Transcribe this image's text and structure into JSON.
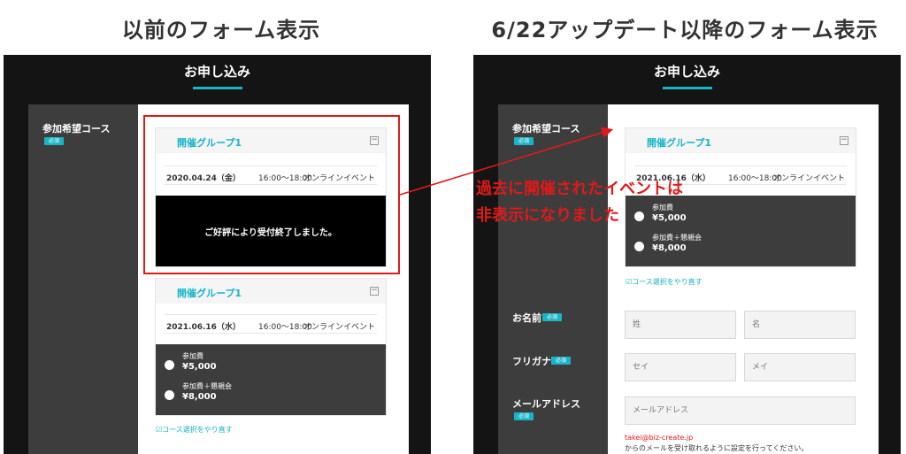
{
  "headings": {
    "before": "以前のフォーム表示",
    "after": "6/22アップデート以降のフォーム表示"
  },
  "form": {
    "title": "お申し込み",
    "course_label": "参加希望コース",
    "required_badge": "必須",
    "name_label": "お名前",
    "kana_label": "フリガナ",
    "email_label": "メールアドレス",
    "reset_link": "コース選択をやり直す"
  },
  "groups": {
    "past": {
      "title": "開催グループ1",
      "date": "2020.04.24（金）",
      "time": "16:00〜18:00",
      "type": "オンラインイベント",
      "closed_message": "ご好評により受付終了しました。"
    },
    "current": {
      "title": "開催グループ1",
      "date": "2021.06.16（水）",
      "time": "16:00〜18:00",
      "type": "オンラインイベント"
    }
  },
  "prices": [
    {
      "name": "参加費",
      "value": "¥5,000"
    },
    {
      "name": "参加費＋懇親会",
      "value": "¥8,000"
    }
  ],
  "inputs": {
    "last_name": "姓",
    "first_name": "名",
    "last_kana": "セイ",
    "first_kana": "メイ",
    "email": "メールアドレス"
  },
  "email_note": {
    "address": "takei@biz-create.jp",
    "text": "からのメールを受け取れるように設定を行ってください。"
  },
  "annotation": {
    "line1": "過去に開催されたイベントは",
    "line2": "非表示になりました"
  },
  "colors": {
    "accent": "#18b4c7",
    "annotation_red": "#e11919"
  }
}
